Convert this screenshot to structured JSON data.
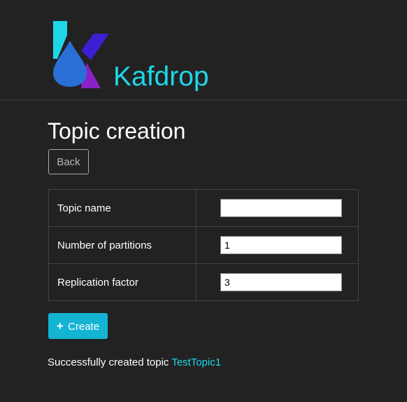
{
  "header": {
    "brand_name": "Kafdrop",
    "logo_icon": "kafdrop-logo-icon",
    "colors": {
      "brand": "#1ed7e8",
      "logo_teal": "#1ed7e8",
      "logo_blue": "#2a6fd6",
      "logo_indigo": "#3b1fd0",
      "logo_purple": "#8b22c8"
    }
  },
  "page": {
    "title": "Topic creation",
    "back_label": "Back"
  },
  "form": {
    "rows": [
      {
        "label": "Topic name",
        "value": ""
      },
      {
        "label": "Number of partitions",
        "value": "1"
      },
      {
        "label": "Replication factor",
        "value": "3"
      }
    ],
    "create_icon": "plus-icon",
    "create_glyph": "+",
    "create_label": "Create",
    "create_color": "#14b4d3"
  },
  "status": {
    "message": "Successfully created topic",
    "topic_link": "TestTopic1"
  }
}
